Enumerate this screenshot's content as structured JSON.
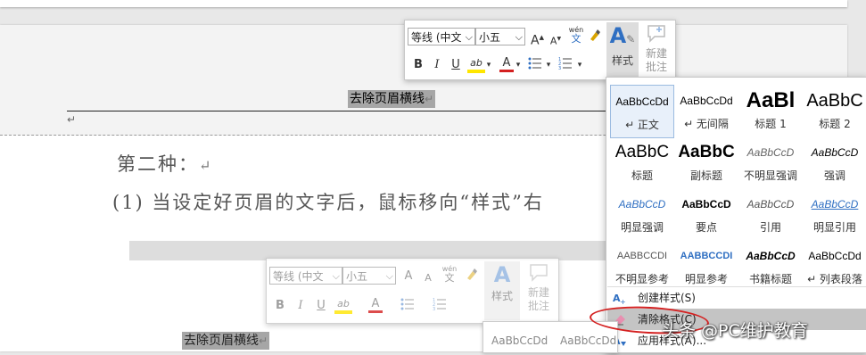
{
  "document": {
    "header_text": "去除页眉横线",
    "return_mark": "↵",
    "para1": "第二种：",
    "para2": "(1) 当设定好页眉的文字后，鼠标移向“样式”右",
    "header_text_2": "去除页眉横线"
  },
  "mini_toolbar": {
    "font_name": "等线 (中文",
    "font_size": "小五",
    "grow_font": "A",
    "shrink_font": "A",
    "phonetic_top": "wén",
    "phonetic_bottom": "文",
    "bold": "B",
    "italic": "I",
    "underline": "U",
    "highlight": "ab",
    "font_color": "A",
    "styles_label": "样式",
    "new_comment_line1": "新建",
    "new_comment_line2": "批注"
  },
  "styles_gallery": {
    "items": [
      {
        "preview": "AaBbCcDd",
        "name": "↵ 正文"
      },
      {
        "preview": "AaBbCcDd",
        "name": "↵ 无间隔"
      },
      {
        "preview": "AaBl",
        "name": "标题 1"
      },
      {
        "preview": "AaBbC",
        "name": "标题 2"
      },
      {
        "preview": "AaBbC",
        "name": "标题"
      },
      {
        "preview": "AaBbC",
        "name": "副标题"
      },
      {
        "preview": "AaBbCcD",
        "name": "不明显强调"
      },
      {
        "preview": "AaBbCcD",
        "name": "强调"
      },
      {
        "preview": "AaBbCcD",
        "name": "明显强调"
      },
      {
        "preview": "AaBbCcD",
        "name": "要点"
      },
      {
        "preview": "AaBbCcD",
        "name": "引用"
      },
      {
        "preview": "AaBbCcD",
        "name": "明显引用"
      },
      {
        "preview": "AABBCCDI",
        "name": "不明显参考"
      },
      {
        "preview": "AABBCCDI",
        "name": "明显参考"
      },
      {
        "preview": "AaBbCcD",
        "name": "书籍标题"
      },
      {
        "preview": "AaBbCcDd",
        "name": "↵ 列表段落"
      }
    ],
    "menu": {
      "create_style": "创建样式(S)",
      "clear_format": "清除格式(C)",
      "apply_styles": "应用样式(A)..."
    }
  },
  "gallery_2": {
    "preview_1": "AaBbCcDd",
    "preview_2": "AaBbCcDd"
  },
  "watermark": "头条 @PC维护教育",
  "colors": {
    "accent": "#2f6fc2",
    "highlight_yellow": "#ffe600",
    "font_red": "#d42020",
    "circle_red": "#d42020"
  }
}
